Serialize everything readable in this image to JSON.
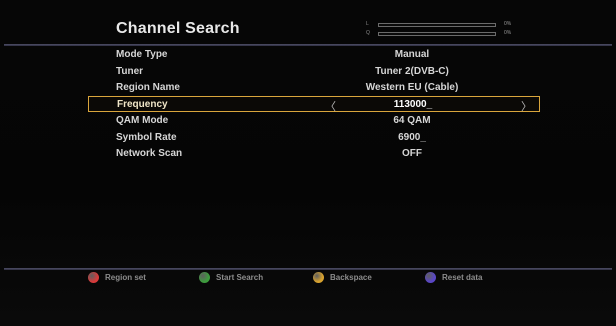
{
  "header": {
    "title": "Channel Search",
    "signal": {
      "level_label": "L",
      "quality_label": "Q",
      "level_value": "0%",
      "quality_value": "0%",
      "level_fraction": 0,
      "quality_fraction": 0
    }
  },
  "settings": {
    "rows": [
      {
        "label": "Mode Type",
        "value": "Manual"
      },
      {
        "label": "Tuner",
        "value": "Tuner 2(DVB-C)"
      },
      {
        "label": "Region Name",
        "value": "Western EU (Cable)"
      },
      {
        "label": "Frequency",
        "value": "113000_",
        "left_arrow": "〈",
        "right_arrow": "〉"
      },
      {
        "label": "QAM Mode",
        "value": "64 QAM"
      },
      {
        "label": "Symbol Rate",
        "value": "6900_"
      },
      {
        "label": "Network Scan",
        "value": "OFF"
      }
    ]
  },
  "footer": {
    "keys": [
      {
        "label": "Region set",
        "color": "#d93a3a"
      },
      {
        "label": "Start Search",
        "color": "#3c9c3c"
      },
      {
        "label": "Backspace",
        "color": "#d9a32e"
      },
      {
        "label": "Reset data",
        "color": "#5a46c8"
      }
    ]
  },
  "colors": {
    "highlight_border": "#d9a53c",
    "background": "#000000"
  }
}
